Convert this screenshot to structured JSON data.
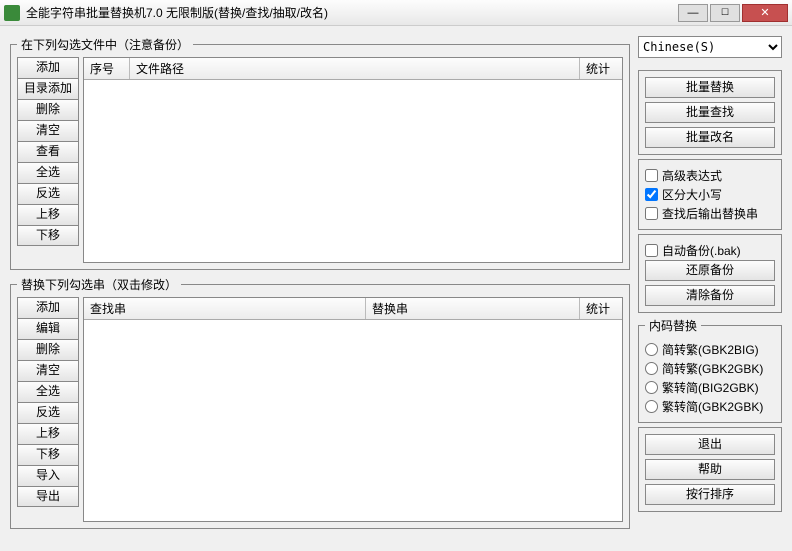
{
  "window": {
    "title": "全能字符串批量替换机7.0 无限制版(替换/查找/抽取/改名)"
  },
  "files_panel": {
    "legend": "在下列勾选文件中（注意备份）",
    "buttons": [
      "添加",
      "目录添加",
      "删除",
      "清空",
      "查看",
      "全选",
      "反选",
      "上移",
      "下移"
    ],
    "columns": {
      "c0": "序号",
      "c1": "文件路径",
      "c2": "统计"
    }
  },
  "strings_panel": {
    "legend": "替换下列勾选串（双击修改）",
    "buttons": [
      "添加",
      "编辑",
      "删除",
      "清空",
      "全选",
      "反选",
      "上移",
      "下移",
      "导入",
      "导出"
    ],
    "columns": {
      "c0": "查找串",
      "c1": "替换串",
      "c2": "统计"
    }
  },
  "right": {
    "encoding_selected": "Chinese(S)",
    "batch": {
      "replace": "批量替换",
      "find": "批量查找",
      "rename": "批量改名"
    },
    "opts": {
      "regex": "高级表达式",
      "case": "区分大小写",
      "outrep": "查找后输出替换串"
    },
    "backup": {
      "auto": "自动备份(.bak)",
      "restore": "还原备份",
      "clear": "清除备份"
    },
    "encoding_conv": {
      "legend": "内码替换",
      "r0": "简转繁(GBK2BIG)",
      "r1": "简转繁(GBK2GBK)",
      "r2": "繁转简(BIG2GBK)",
      "r3": "繁转简(GBK2GBK)"
    },
    "exit": "退出",
    "help": "帮助",
    "sort": "按行排序"
  }
}
